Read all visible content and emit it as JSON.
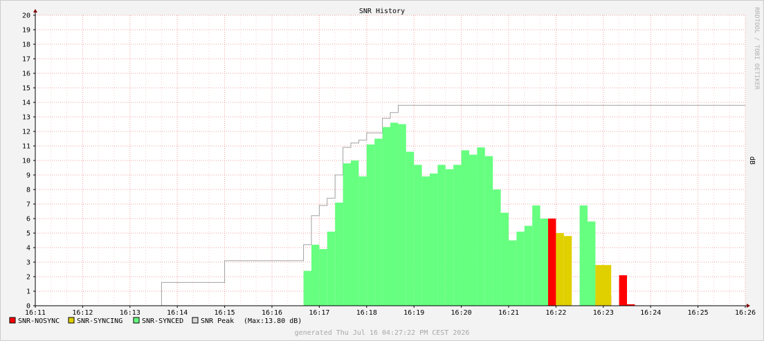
{
  "page": {
    "watermark": "RRDTOOL / TOBI OETIKER",
    "generated": "generated Thu Jul 16 04:27:22 PM CEST 2026"
  },
  "colors": {
    "background": "#f3f3f3",
    "canvas": "#ffffff",
    "grid": "#ffaaaa",
    "axis": "#800000",
    "nosync": "#ff0000",
    "syncing": "#e0d000",
    "synced": "#66ff80",
    "peak": "#a0a0a0"
  },
  "chart_data": {
    "type": "area",
    "title": "SNR History",
    "ylabel": "dB",
    "xlabel": "",
    "ylim": [
      0,
      20
    ],
    "xlim": [
      "16:11",
      "16:26"
    ],
    "grid": true,
    "legend_position": "bottom-left",
    "x_ticks": [
      "16:11",
      "16:12",
      "16:13",
      "16:14",
      "16:15",
      "16:16",
      "16:17",
      "16:18",
      "16:19",
      "16:20",
      "16:21",
      "16:22",
      "16:23",
      "16:24",
      "16:25",
      "16:26"
    ],
    "y_ticks": [
      0,
      1,
      2,
      3,
      4,
      5,
      6,
      7,
      8,
      9,
      10,
      11,
      12,
      13,
      14,
      15,
      16,
      17,
      18,
      19,
      20
    ],
    "legend": [
      {
        "name": "SNR-NOSYNC",
        "color": "#ff0000"
      },
      {
        "name": "SNR-SYNCING",
        "color": "#e0d000"
      },
      {
        "name": "SNR-SYNCED",
        "color": "#66ff80"
      },
      {
        "name": "SNR Peak",
        "color": "#d8d8d8"
      }
    ],
    "peak_note": "(Max:13.80 dB)",
    "series": [
      {
        "name": "SNR-SYNCED",
        "steps": [
          {
            "start": "16:16:40",
            "end": "16:16:50",
            "value": 2.4
          },
          {
            "start": "16:16:50",
            "end": "16:17:00",
            "value": 4.2
          },
          {
            "start": "16:17:00",
            "end": "16:17:10",
            "value": 3.9
          },
          {
            "start": "16:17:10",
            "end": "16:17:20",
            "value": 5.1
          },
          {
            "start": "16:17:20",
            "end": "16:17:30",
            "value": 7.1
          },
          {
            "start": "16:17:30",
            "end": "16:17:40",
            "value": 9.8
          },
          {
            "start": "16:17:40",
            "end": "16:17:50",
            "value": 10.0
          },
          {
            "start": "16:17:50",
            "end": "16:18:00",
            "value": 8.9
          },
          {
            "start": "16:18:00",
            "end": "16:18:10",
            "value": 11.1
          },
          {
            "start": "16:18:10",
            "end": "16:18:20",
            "value": 11.5
          },
          {
            "start": "16:18:20",
            "end": "16:18:30",
            "value": 12.3
          },
          {
            "start": "16:18:30",
            "end": "16:18:40",
            "value": 12.6
          },
          {
            "start": "16:18:40",
            "end": "16:18:50",
            "value": 12.5
          },
          {
            "start": "16:18:50",
            "end": "16:19:00",
            "value": 10.6
          },
          {
            "start": "16:19:00",
            "end": "16:19:10",
            "value": 9.7
          },
          {
            "start": "16:19:10",
            "end": "16:19:20",
            "value": 8.9
          },
          {
            "start": "16:19:20",
            "end": "16:19:30",
            "value": 9.1
          },
          {
            "start": "16:19:30",
            "end": "16:19:40",
            "value": 9.7
          },
          {
            "start": "16:19:40",
            "end": "16:19:50",
            "value": 9.4
          },
          {
            "start": "16:19:50",
            "end": "16:20:00",
            "value": 9.7
          },
          {
            "start": "16:20:00",
            "end": "16:20:10",
            "value": 10.7
          },
          {
            "start": "16:20:10",
            "end": "16:20:20",
            "value": 10.4
          },
          {
            "start": "16:20:20",
            "end": "16:20:30",
            "value": 10.9
          },
          {
            "start": "16:20:30",
            "end": "16:20:40",
            "value": 10.3
          },
          {
            "start": "16:20:40",
            "end": "16:20:50",
            "value": 8.0
          },
          {
            "start": "16:20:50",
            "end": "16:21:00",
            "value": 6.4
          },
          {
            "start": "16:21:00",
            "end": "16:21:10",
            "value": 4.5
          },
          {
            "start": "16:21:10",
            "end": "16:21:20",
            "value": 5.1
          },
          {
            "start": "16:21:20",
            "end": "16:21:30",
            "value": 5.5
          },
          {
            "start": "16:21:30",
            "end": "16:21:40",
            "value": 6.9
          },
          {
            "start": "16:21:40",
            "end": "16:21:50",
            "value": 6.0
          },
          {
            "start": "16:22:30",
            "end": "16:22:40",
            "value": 6.9
          },
          {
            "start": "16:22:40",
            "end": "16:22:50",
            "value": 5.8
          }
        ]
      },
      {
        "name": "SNR-NOSYNC",
        "steps": [
          {
            "start": "16:21:50",
            "end": "16:22:00",
            "value": 6.0
          },
          {
            "start": "16:22:50",
            "end": "16:23:00",
            "value": 0.3
          },
          {
            "start": "16:23:00",
            "end": "16:23:10",
            "value": 0.7
          },
          {
            "start": "16:23:20",
            "end": "16:23:30",
            "value": 2.1
          },
          {
            "start": "16:23:30",
            "end": "16:23:40",
            "value": 0.1
          }
        ]
      },
      {
        "name": "SNR-SYNCING",
        "steps": [
          {
            "start": "16:22:00",
            "end": "16:22:10",
            "value": 5.0
          },
          {
            "start": "16:22:10",
            "end": "16:22:20",
            "value": 4.8
          },
          {
            "start": "16:22:50",
            "end": "16:23:10",
            "value": 2.8
          }
        ]
      },
      {
        "name": "SNR Peak",
        "line_points": [
          [
            "16:13:40",
            0.0
          ],
          [
            "16:13:40",
            1.6
          ],
          [
            "16:15:00",
            1.6
          ],
          [
            "16:15:00",
            3.1
          ],
          [
            "16:16:40",
            3.1
          ],
          [
            "16:16:40",
            4.2
          ],
          [
            "16:16:50",
            4.2
          ],
          [
            "16:16:50",
            6.2
          ],
          [
            "16:17:00",
            6.2
          ],
          [
            "16:17:00",
            6.9
          ],
          [
            "16:17:10",
            6.9
          ],
          [
            "16:17:10",
            7.4
          ],
          [
            "16:17:20",
            7.4
          ],
          [
            "16:17:20",
            9.0
          ],
          [
            "16:17:30",
            9.0
          ],
          [
            "16:17:30",
            10.9
          ],
          [
            "16:17:40",
            10.9
          ],
          [
            "16:17:40",
            11.2
          ],
          [
            "16:17:50",
            11.2
          ],
          [
            "16:17:50",
            11.4
          ],
          [
            "16:18:00",
            11.4
          ],
          [
            "16:18:00",
            11.9
          ],
          [
            "16:18:20",
            11.9
          ],
          [
            "16:18:20",
            12.9
          ],
          [
            "16:18:30",
            12.9
          ],
          [
            "16:18:30",
            13.3
          ],
          [
            "16:18:40",
            13.3
          ],
          [
            "16:18:40",
            13.8
          ],
          [
            "16:26:00",
            13.8
          ]
        ]
      }
    ]
  }
}
